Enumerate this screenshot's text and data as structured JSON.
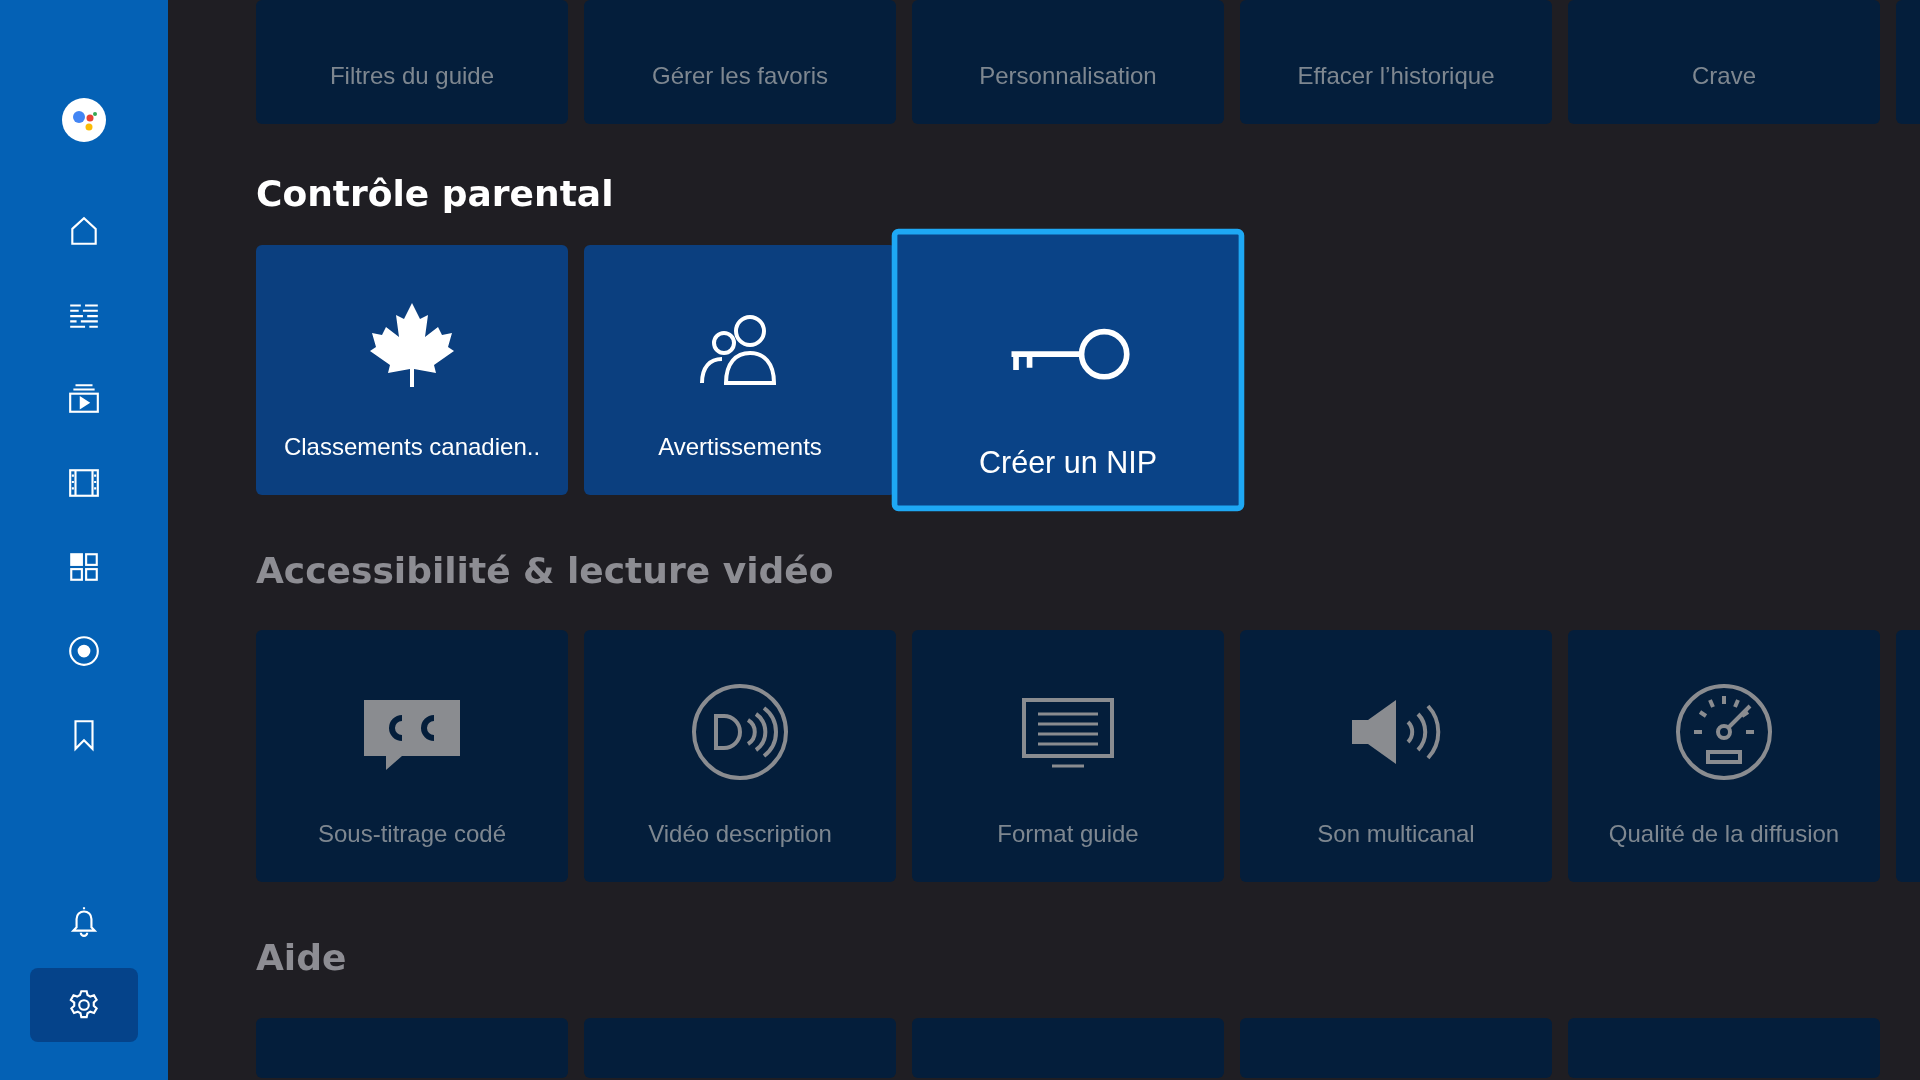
{
  "sidebar": {
    "items": [
      {
        "kind": "home",
        "selected": false
      },
      {
        "kind": "guide",
        "selected": false
      },
      {
        "kind": "tv",
        "selected": false
      },
      {
        "kind": "film",
        "selected": false
      },
      {
        "kind": "apps",
        "selected": false
      },
      {
        "kind": "record",
        "selected": false
      },
      {
        "kind": "bookmark",
        "selected": false
      }
    ],
    "bottom_items": [
      {
        "kind": "bell",
        "selected": false
      },
      {
        "kind": "settings",
        "selected": true
      }
    ]
  },
  "sections": [
    {
      "active": false,
      "tiles": [
        {
          "label": "Filtres du guide",
          "kind": "none",
          "focused": false
        },
        {
          "label": "Gérer les favoris",
          "kind": "none",
          "focused": false
        },
        {
          "label": "Personnalisation",
          "kind": "none",
          "focused": false
        },
        {
          "label": "Effacer l’historique",
          "kind": "none",
          "focused": false
        },
        {
          "label": "Crave",
          "kind": "none",
          "focused": false
        },
        {
          "kind": "stub",
          "focused": false
        }
      ]
    },
    {
      "title": "Contrôle parental",
      "active": true,
      "tiles": [
        {
          "label": "Classements canadien..",
          "kind": "maple",
          "focused": false
        },
        {
          "label": "Avertissements",
          "kind": "people",
          "focused": false
        },
        {
          "label": "Créer un NIP",
          "kind": "key",
          "focused": true
        }
      ]
    },
    {
      "title": "Accessibilité & lecture vidéo",
      "active": false,
      "tiles": [
        {
          "label": "Sous-titrage codé",
          "kind": "cc",
          "focused": false
        },
        {
          "label": "Vidéo description",
          "kind": "dv",
          "focused": false
        },
        {
          "label": "Format guide",
          "kind": "screen",
          "focused": false
        },
        {
          "label": "Son multicanal",
          "kind": "speaker",
          "focused": false
        },
        {
          "label": "Qualité de la diffusion",
          "kind": "gauge",
          "focused": false
        },
        {
          "kind": "stub",
          "focused": false
        }
      ]
    },
    {
      "title": "Aide",
      "active": false,
      "tiles": [
        {
          "kind": "none",
          "focused": false
        },
        {
          "kind": "none",
          "focused": false
        },
        {
          "kind": "none",
          "focused": false
        },
        {
          "kind": "none",
          "focused": false
        },
        {
          "kind": "none",
          "focused": false
        }
      ]
    }
  ]
}
